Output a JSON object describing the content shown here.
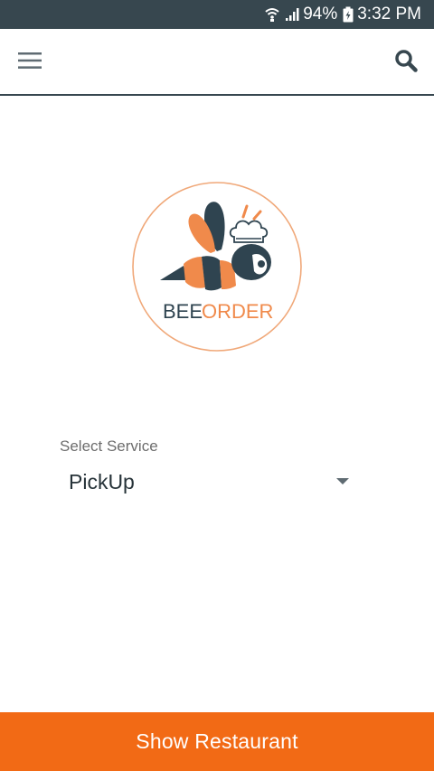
{
  "status_bar": {
    "battery": "94%",
    "time": "3:32 PM",
    "icons": [
      "wifi-icon",
      "signal-icon",
      "battery-charging-icon"
    ]
  },
  "toolbar": {
    "menu_icon": "hamburger-menu-icon",
    "search_icon": "search-icon"
  },
  "logo": {
    "text_bee": "BEE",
    "text_order": "ORDER",
    "colors": {
      "dark": "#2f4450",
      "accent": "#f08a4b"
    }
  },
  "service_select": {
    "label": "Select Service",
    "selected": "PickUp"
  },
  "footer": {
    "button_label": "Show Restaurant",
    "color": "#f26a15"
  }
}
